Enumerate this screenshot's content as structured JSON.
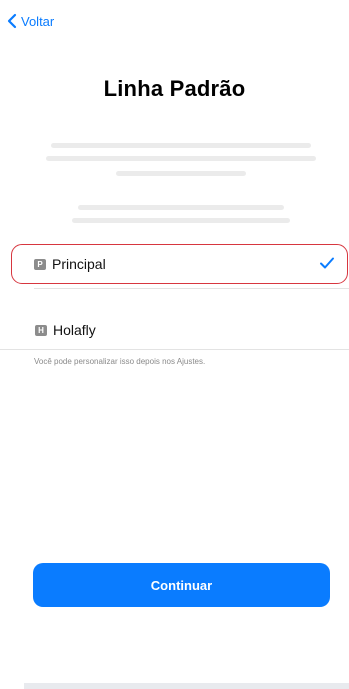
{
  "nav": {
    "back_label": "Voltar"
  },
  "title": "Linha Padrão",
  "options": [
    {
      "badge": "P",
      "label": "Principal",
      "selected": true
    },
    {
      "badge": "H",
      "label": "Holafly",
      "selected": false
    }
  ],
  "hint": "Você pode personalizar isso depois nos Ajustes.",
  "continue_label": "Continuar",
  "colors": {
    "accent": "#0a7cff",
    "selection_border": "#d7363f",
    "badge": "#8c8c8c"
  }
}
